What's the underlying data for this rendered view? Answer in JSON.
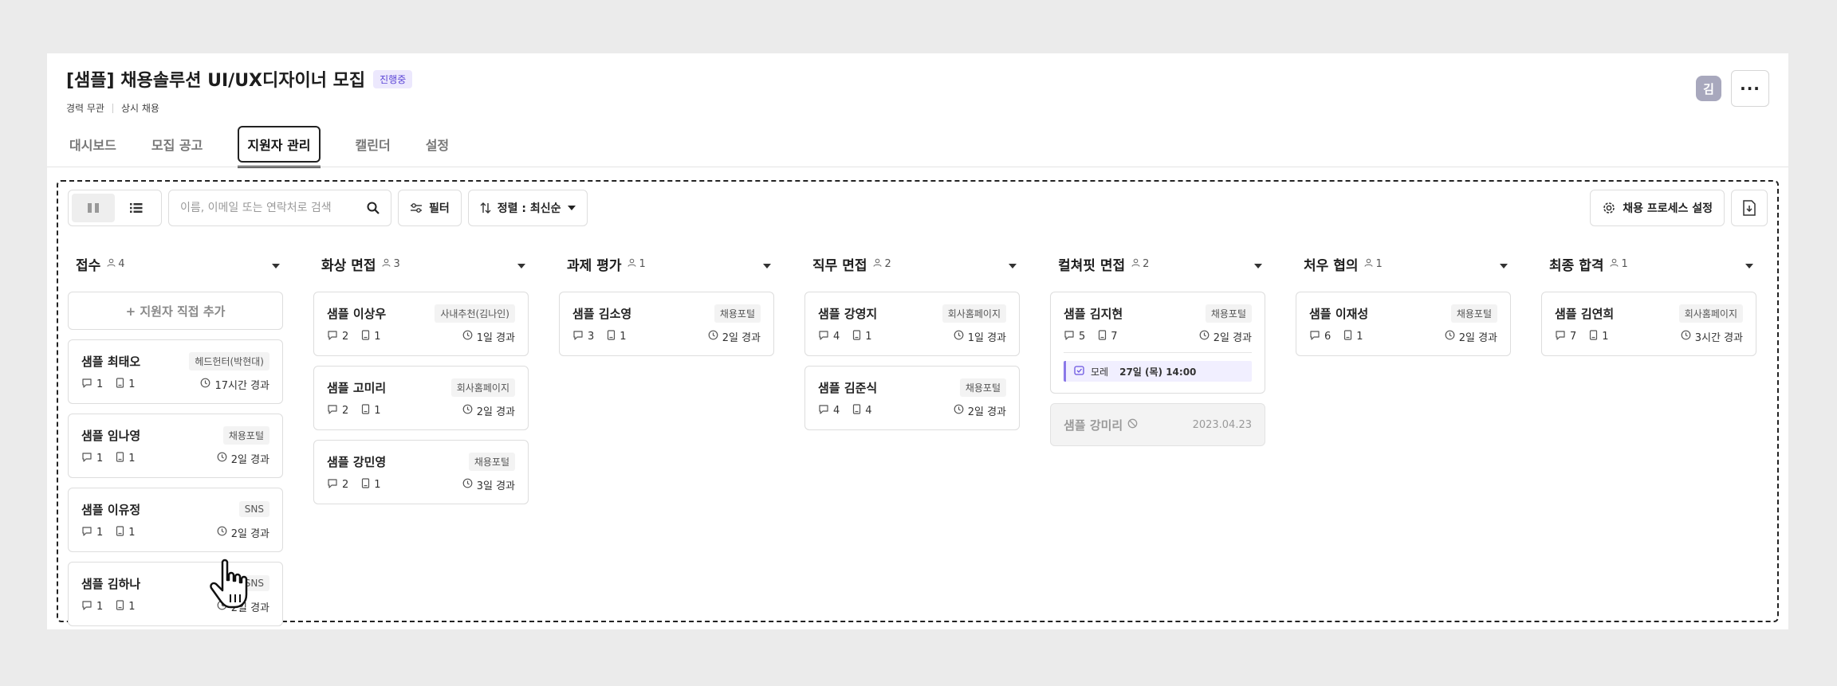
{
  "header": {
    "title": "[샘플] 채용솔루션 UI/UX디자이너 모집",
    "status": "진행중",
    "meta": [
      "경력 무관",
      "상시 채용"
    ],
    "avatar_initial": "김"
  },
  "tabs": [
    {
      "label": "대시보드",
      "active": false
    },
    {
      "label": "모집 공고",
      "active": false
    },
    {
      "label": "지원자 관리",
      "active": true
    },
    {
      "label": "캘린더",
      "active": false
    },
    {
      "label": "설정",
      "active": false
    }
  ],
  "toolbar": {
    "search_placeholder": "이름, 이메일 또는 연락처로 검색",
    "filter_label": "필터",
    "sort_label": "정렬 : 최신순",
    "process_label": "채용 프로세스 설정"
  },
  "add_applicant_label": "+ 지원자 직접 추가",
  "columns": [
    {
      "title": "접수",
      "count": "4",
      "cards": [
        {
          "name": "샘플 최태오",
          "source": "헤드헌터(박현대)",
          "comments": "1",
          "docs": "1",
          "elapsed": "17시간 경과"
        },
        {
          "name": "샘플 임나영",
          "source": "채용포털",
          "comments": "1",
          "docs": "1",
          "elapsed": "2일 경과"
        },
        {
          "name": "샘플 이유정",
          "source": "SNS",
          "comments": "1",
          "docs": "1",
          "elapsed": "2일 경과"
        },
        {
          "name": "샘플 김하나",
          "source": "SNS",
          "comments": "1",
          "docs": "1",
          "elapsed": "2일 경과"
        }
      ]
    },
    {
      "title": "화상 면접",
      "count": "3",
      "cards": [
        {
          "name": "샘플 이상우",
          "source": "사내추천(김나인)",
          "comments": "2",
          "docs": "1",
          "elapsed": "1일 경과"
        },
        {
          "name": "샘플 고미리",
          "source": "회사홈페이지",
          "comments": "2",
          "docs": "1",
          "elapsed": "2일 경과"
        },
        {
          "name": "샘플 강민영",
          "source": "채용포털",
          "comments": "2",
          "docs": "1",
          "elapsed": "3일 경과"
        }
      ]
    },
    {
      "title": "과제 평가",
      "count": "1",
      "cards": [
        {
          "name": "샘플 김소영",
          "source": "채용포털",
          "comments": "3",
          "docs": "1",
          "elapsed": "2일 경과"
        }
      ]
    },
    {
      "title": "직무 면접",
      "count": "2",
      "cards": [
        {
          "name": "샘플 강영지",
          "source": "회사홈페이지",
          "comments": "4",
          "docs": "1",
          "elapsed": "1일 경과"
        },
        {
          "name": "샘플 김준식",
          "source": "채용포털",
          "comments": "4",
          "docs": "4",
          "elapsed": "2일 경과"
        }
      ]
    },
    {
      "title": "컬쳐핏 면접",
      "count": "2",
      "cards": [
        {
          "name": "샘플 김지현",
          "source": "채용포털",
          "comments": "5",
          "docs": "7",
          "elapsed": "2일 경과",
          "schedule": {
            "day": "모레",
            "when": "27일 (목) 14:00"
          }
        }
      ],
      "dropped": {
        "name": "샘플 강미리",
        "date": "2023.04.23"
      }
    },
    {
      "title": "처우 협의",
      "count": "1",
      "cards": [
        {
          "name": "샘플 이재성",
          "source": "채용포털",
          "comments": "6",
          "docs": "1",
          "elapsed": "2일 경과"
        }
      ]
    },
    {
      "title": "최종 합격",
      "count": "1",
      "cards": [
        {
          "name": "샘플 김연희",
          "source": "회사홈페이지",
          "comments": "7",
          "docs": "1",
          "elapsed": "3시간 경과"
        }
      ]
    }
  ]
}
